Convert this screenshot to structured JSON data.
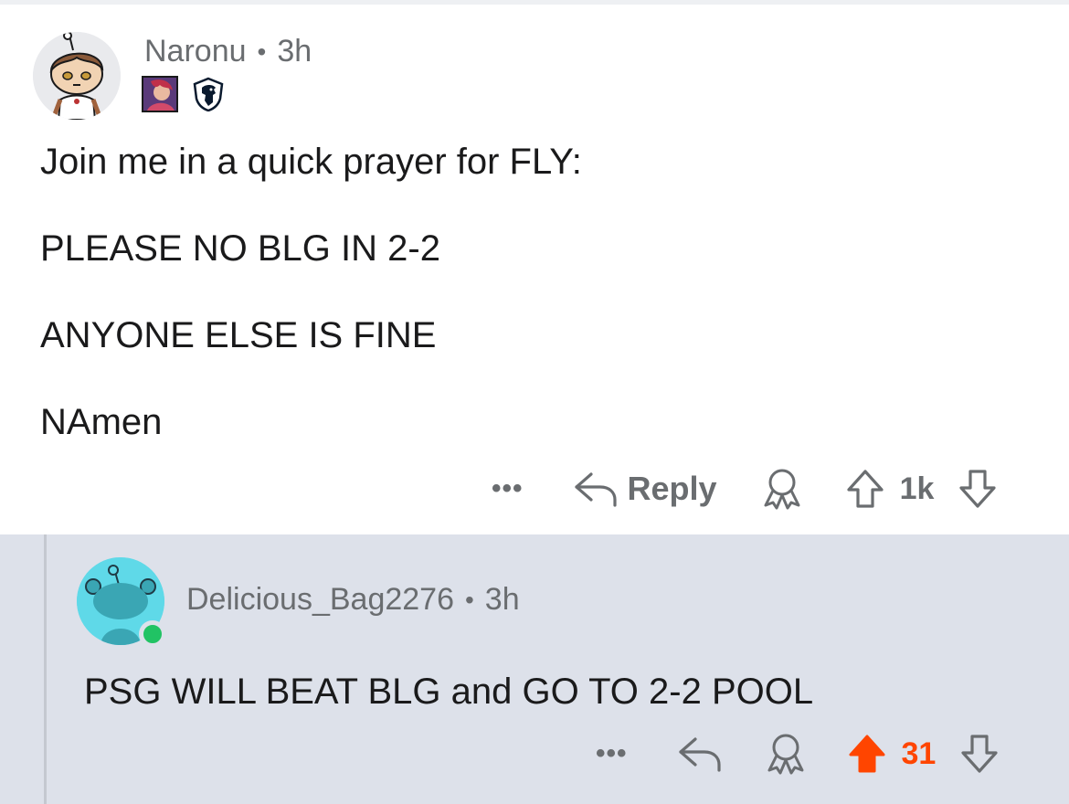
{
  "parent": {
    "author": "Naronu",
    "separator": "•",
    "time": "3h",
    "body": [
      "Join me in a quick prayer for FLY:",
      "PLEASE NO BLG IN 2-2",
      "ANYONE ELSE IS FINE",
      "NAmen"
    ],
    "actions": {
      "more": "•••",
      "reply_label": "Reply",
      "vote_count": "1k"
    },
    "icons": [
      "more-icon",
      "reply-icon",
      "award-icon",
      "upvote-icon",
      "downvote-icon"
    ]
  },
  "child": {
    "author": "Delicious_Bag2276",
    "separator": "•",
    "time": "3h",
    "body": "PSG WILL BEAT BLG and GO TO 2-2 POOL",
    "actions": {
      "more": "•••",
      "vote_count": "31"
    },
    "upvoted": true
  },
  "colors": {
    "meta_gray": "#6a6d70",
    "child_bg": "#dde1ea",
    "upvote_orange": "#ff4500",
    "online_green": "#21c364",
    "child_avatar_bg": "#5fd9e8"
  }
}
